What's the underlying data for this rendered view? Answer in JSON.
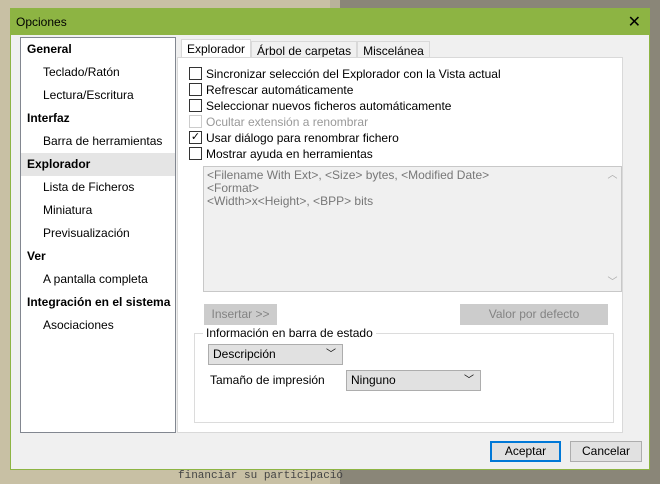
{
  "window": {
    "title": "Opciones"
  },
  "sidebar": {
    "items": [
      {
        "label": "General",
        "level": 0
      },
      {
        "label": "Teclado/Ratón",
        "level": 1
      },
      {
        "label": "Lectura/Escritura",
        "level": 1
      },
      {
        "label": "Interfaz",
        "level": 0
      },
      {
        "label": "Barra de herramientas",
        "level": 1
      },
      {
        "label": "Explorador",
        "level": 0,
        "selected": true
      },
      {
        "label": "Lista de Ficheros",
        "level": 1
      },
      {
        "label": "Miniatura",
        "level": 1
      },
      {
        "label": "Previsualización",
        "level": 1
      },
      {
        "label": "Ver",
        "level": 0
      },
      {
        "label": "A pantalla completa",
        "level": 1
      },
      {
        "label": "Integración en el sistema",
        "level": 0
      },
      {
        "label": "Asociaciones",
        "level": 1
      }
    ]
  },
  "tabs": [
    {
      "label": "Explorador",
      "active": true
    },
    {
      "label": "Árbol de carpetas"
    },
    {
      "label": "Miscelánea"
    }
  ],
  "options": [
    {
      "label": "Sincronizar selección del Explorador con la Vista actual",
      "checked": false
    },
    {
      "label": "Refrescar automáticamente",
      "checked": false
    },
    {
      "label": "Seleccionar nuevos ficheros automáticamente",
      "checked": false
    },
    {
      "label": "Ocultar extensión a renombrar",
      "checked": false,
      "disabled": true
    },
    {
      "label": "Usar diálogo para renombrar fichero",
      "checked": true
    },
    {
      "label": "Mostrar ayuda en herramientas",
      "checked": false
    }
  ],
  "template_text": "<Filename With Ext>, <Size> bytes, <Modified Date>\n<Format>\n<Width>x<Height>, <BPP> bits",
  "insert_label": "Insertar >>",
  "default_label": "Valor por defecto",
  "status_group": {
    "title": "Información en barra de estado",
    "select_value": "Descripción",
    "print_size_label": "Tamaño de impresión",
    "print_size_value": "Ninguno"
  },
  "footer": {
    "ok": "Aceptar",
    "cancel": "Cancelar"
  },
  "background_text": "financiar su participació"
}
